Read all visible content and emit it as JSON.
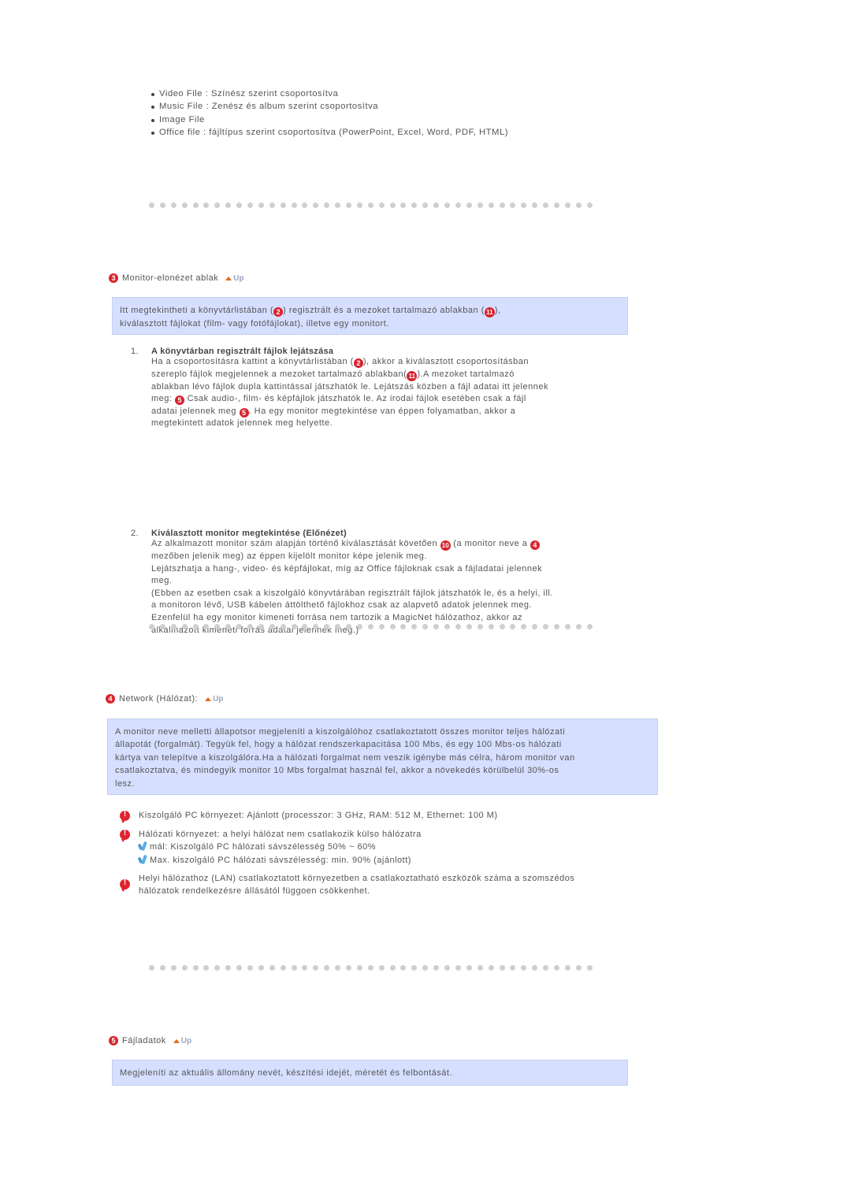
{
  "file_types": [
    "Video File : Színész szerint csoportosítva",
    "Music File : Zenész és album szerint csoportosítva",
    "Image File",
    "Office file : fájltípus szerint csoportosítva (PowerPoint, Excel, Word, PDF, HTML)"
  ],
  "sections": {
    "monitor_preview": {
      "number": "3",
      "title": "Monitor-elonézet ablak",
      "up_label": "Up",
      "box_text_parts": [
        "Itt megtekintheti a könyvtárlistában (",
        "2",
        ") regisztrált és a mezoket tartalmazó ablakban (",
        "11",
        "),",
        "kiválasztott fájlokat (film- vagy fotófájlokat), illetve egy monitort."
      ],
      "items": [
        {
          "number": "1.",
          "heading": "A könyvtárban regisztrált fájlok lejátszása",
          "lines": [
            [
              "Ha a csoportosításra kattint a könyvtárlistában (",
              "2",
              "), akkor a kiválasztott csoportosításban"
            ],
            [
              "szereplo fájlok megjelennek a mezoket tartalmazó ablakban(",
              "11",
              ").A mezoket tartalmazó"
            ],
            [
              "ablakban lévo fájlok dupla kattintással játszhatók le. Lejátszás közben a fájl adatai itt jelennek"
            ],
            [
              "meg: ",
              "5",
              " Csak audio-, film- és képfájlok játszhatók le. Az irodai fájlok esetében csak a fájl"
            ],
            [
              "adatai jelennek meg ",
              "5",
              ". Ha egy monitor megtekintése van éppen folyamatban, akkor a"
            ],
            [
              "megtekintett adatok jelennek meg helyette."
            ]
          ]
        },
        {
          "number": "2.",
          "heading": "Kiválasztott monitor megtekintése (Előnézet)",
          "lines": [
            [
              "Az alkalmazott monitor szám alapján történő kiválasztását követően ",
              "10",
              " (a monitor neve a ",
              "4"
            ],
            [
              "mezőben jelenik meg) az éppen kijelölt monitor képe jelenik meg."
            ],
            [
              "Lejátszhatja a hang-, video- és képfájlokat, míg az Office fájloknak csak a fájladatai jelennek"
            ],
            [
              "meg."
            ],
            [
              "(Ebben az esetben csak a kiszolgáló könyvtárában regisztrált fájlok játszhatók le, és a helyi, ill."
            ],
            [
              "a monitoron lévő, USB kábelen áttölthető fájlokhoz csak az alapvető adatok jelennek meg."
            ],
            [
              "Ezenfelül ha egy monitor kimeneti forrása nem tartozik a MagicNet hálózathoz, akkor az"
            ],
            [
              "alkalmazott kimeneti forrás adatai jelennek meg.)"
            ]
          ]
        }
      ]
    },
    "network": {
      "number": "4",
      "title": "Network (Hálózat):",
      "up_label": "Up",
      "box_lines": [
        "A monitor neve melletti állapotsor megjeleníti a kiszolgálóhoz csatlakoztatott összes monitor teljes hálózati",
        "állapotát (forgalmát). Tegyük fel, hogy a hálózat rendszerkapacitása 100 Mbs, és egy 100 Mbs-os hálózati",
        "kártya van telepítve a kiszolgálóra.Ha a hálózati forgalmat nem veszik igénybe más célra, három monitor van",
        "csatlakoztatva, és mindegyik monitor 10 Mbs forgalmat használ fel, akkor a növekedés körülbelül 30%-os",
        "lesz."
      ],
      "notes": [
        {
          "lines": [
            "Kiszolgáló PC környezet: Ajánlott (processzor: 3 GHz, RAM: 512 M, Ethernet: 100 M)"
          ],
          "sub": []
        },
        {
          "lines": [
            "Hálózati környezet: a helyi hálózat nem csatlakozik külso hálózatra"
          ],
          "sub": [
            "mál: Kiszolgáló PC hálózati sávszélesség 50% ~ 60%",
            "Max. kiszolgáló PC hálózati sávszélesség: min. 90% (ajánlott)"
          ]
        },
        {
          "lines": [
            "Helyi hálózathoz (LAN) csatlakoztatott környezetben a csatlakoztatható eszközök száma a szomszédos",
            "hálózatok rendelkezésre állásától függoen csökkenhet."
          ],
          "sub": []
        }
      ]
    },
    "file_data": {
      "number": "5",
      "title": "Fájladatok",
      "up_label": "Up",
      "box_text": "Megjeleníti az aktuális állomány nevét, készítési idejét, méretét és felbontását."
    }
  },
  "colors": {
    "box_bg": "#d6dfff",
    "badge_red": "#d9232e",
    "up_arrow": "#e06a1f",
    "dot_gray": "#cfcfcf"
  }
}
